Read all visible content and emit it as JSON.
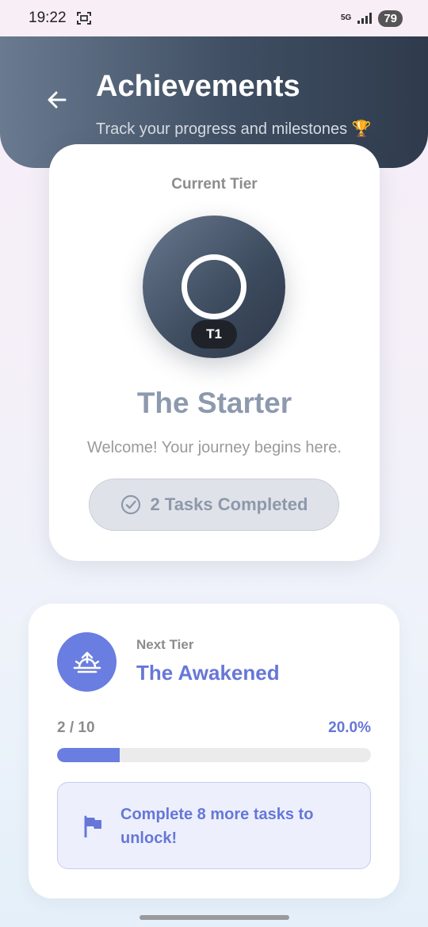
{
  "status_bar": {
    "time": "19:22",
    "network": "5G",
    "battery": "79"
  },
  "header": {
    "title": "Achievements",
    "subtitle": "Track your progress and milestones 🏆"
  },
  "current_tier": {
    "label": "Current Tier",
    "badge": "T1",
    "name": "The Starter",
    "description": "Welcome! Your journey begins here.",
    "tasks_completed": "2 Tasks Completed"
  },
  "next_tier": {
    "label": "Next Tier",
    "name": "The Awakened",
    "progress_count": "2 / 10",
    "progress_percent": "20.0%",
    "progress_fraction": 0.2,
    "unlock_message": "Complete 8 more tasks to unlock!"
  },
  "colors": {
    "accent": "#6a7de0",
    "header_dark": "#3f4e62",
    "tier_name": "#8d99ad"
  },
  "icons": {
    "back": "arrow-left-icon",
    "screenshot": "screenshot-icon",
    "check": "check-circle-icon",
    "sunrise": "sunrise-icon",
    "flag": "flag-icon"
  }
}
